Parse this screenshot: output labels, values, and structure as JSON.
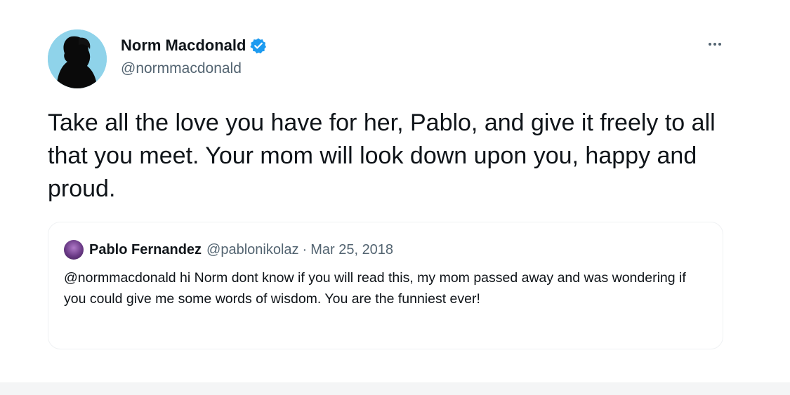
{
  "tweet": {
    "author": {
      "display_name": "Norm Macdonald",
      "handle": "@normmacdonald",
      "verified": true,
      "avatar_icon": "profile-silhouette",
      "avatar_bg": "#8fd3ea"
    },
    "text": "Take all the love you have for her, Pablo, and give it freely to all that you meet. Your mom will look down upon you, happy and proud.",
    "more_icon": "more-horizontal-icon"
  },
  "quoted_tweet": {
    "author": {
      "display_name": "Pablo Fernandez",
      "handle": "@pablonikolaz",
      "avatar_icon": "profile-photo"
    },
    "separator": "·",
    "date": "Mar 25, 2018",
    "text": "@normmacdonald hi Norm dont know if you will read this, my mom passed away and was wondering if you could give me some words of wisdom. You are the funniest ever!"
  },
  "colors": {
    "verified_blue": "#1d9bf0",
    "secondary_text": "#536471",
    "primary_text": "#0f1419"
  }
}
